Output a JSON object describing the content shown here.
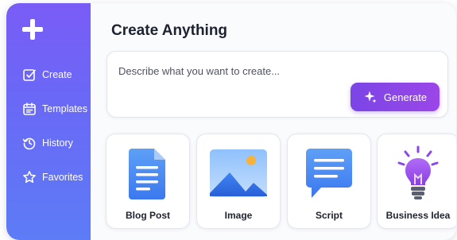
{
  "sidebar": {
    "items": [
      {
        "label": "Create",
        "icon": "edit-square-icon"
      },
      {
        "label": "Templates",
        "icon": "calendar-icon"
      },
      {
        "label": "History",
        "icon": "history-icon"
      },
      {
        "label": "Favorites",
        "icon": "star-icon"
      }
    ]
  },
  "main": {
    "title": "Create Anything",
    "prompt": {
      "placeholder": "Describe what you want to create...",
      "value": ""
    },
    "generate_label": "Generate",
    "cards": [
      {
        "label": "Blog Post",
        "icon": "document-icon"
      },
      {
        "label": "Image",
        "icon": "image-icon"
      },
      {
        "label": "Script",
        "icon": "chat-bubble-icon"
      },
      {
        "label": "Business Idea",
        "icon": "lightbulb-icon"
      }
    ]
  },
  "colors": {
    "sidebar_top": "#7a5cf6",
    "sidebar_bottom": "#5d7cf6",
    "accent": "#8a46e7",
    "icon_blue": "#3d7cf0"
  }
}
